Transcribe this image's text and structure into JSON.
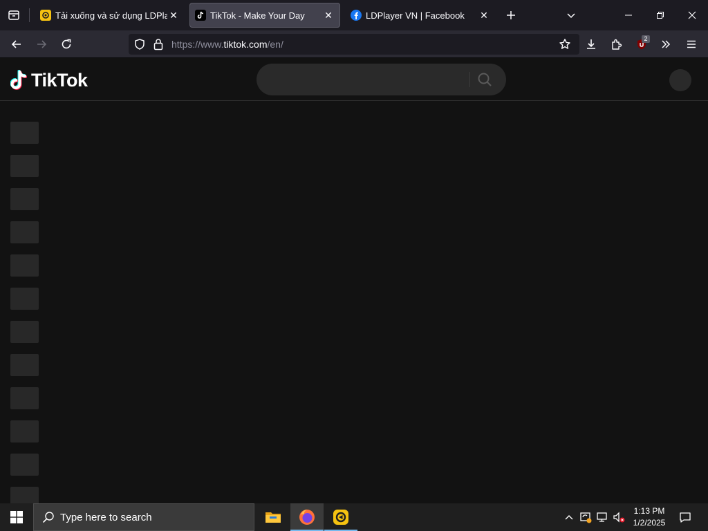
{
  "browser": {
    "tabs": [
      {
        "title": "Tải xuống và sử dụng LDPlayer",
        "favicon": "ldplayer-icon",
        "active": false
      },
      {
        "title": "TikTok - Make Your Day",
        "favicon": "tiktok-icon",
        "active": true
      },
      {
        "title": "LDPlayer VN | Facebook",
        "favicon": "facebook-icon",
        "active": false
      }
    ],
    "url_prefix": "https://www.",
    "url_domain": "tiktok.com",
    "url_suffix": "/en/",
    "extension_badge": "2"
  },
  "page": {
    "logo_text": "TikTok",
    "search_placeholder": "",
    "skeleton_items": 12
  },
  "taskbar": {
    "search_placeholder": "Type here to search",
    "time": "1:13 PM",
    "date": "1/2/2025"
  },
  "colors": {
    "browser_chrome": "#1c1b22",
    "navbar": "#2b2a33",
    "page_bg": "#121212",
    "skeleton": "#282828",
    "taskbar": "#1f1f1f",
    "tiktok_cyan": "#25f4ee",
    "tiktok_red": "#fe2c55",
    "ldplayer_yellow": "#f5c211",
    "facebook_blue": "#1877f2"
  }
}
